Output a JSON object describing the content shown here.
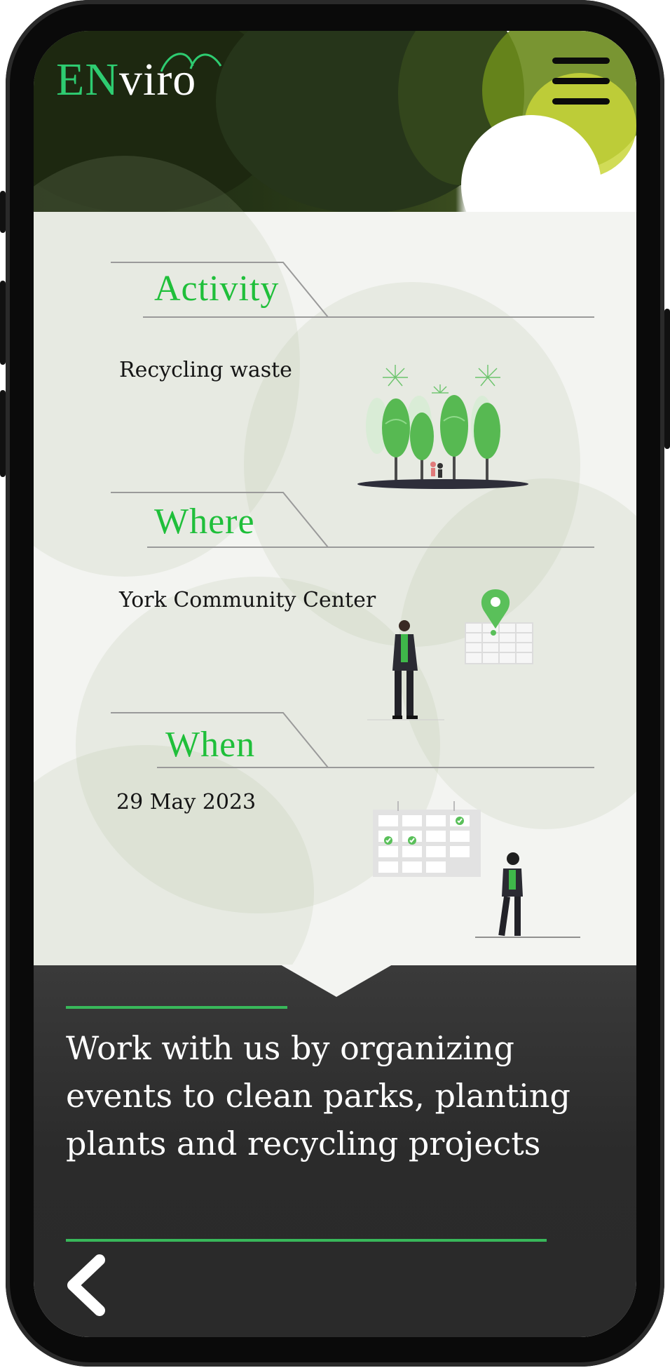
{
  "header": {
    "logo_en": "EN",
    "logo_viro": "viro",
    "menu_icon": "hamburger-menu-icon"
  },
  "sections": {
    "activity": {
      "title": "Activity",
      "text": "Recycling waste",
      "illustration": "trees-park-illustration"
    },
    "where": {
      "title": "Where",
      "text": "York Community Center",
      "illustration": "map-pin-person-illustration"
    },
    "when": {
      "title": "When",
      "text": "29 May 2023",
      "illustration": "calendar-person-illustration"
    }
  },
  "footer": {
    "tagline": "Work with us by organizing events to clean parks, planting plants and recycling projects",
    "back_icon": "chevron-left-icon"
  },
  "colors": {
    "accent_green": "#1fbf3a",
    "footer_bg": "#2b2b2b",
    "line_green": "#38b85a"
  }
}
